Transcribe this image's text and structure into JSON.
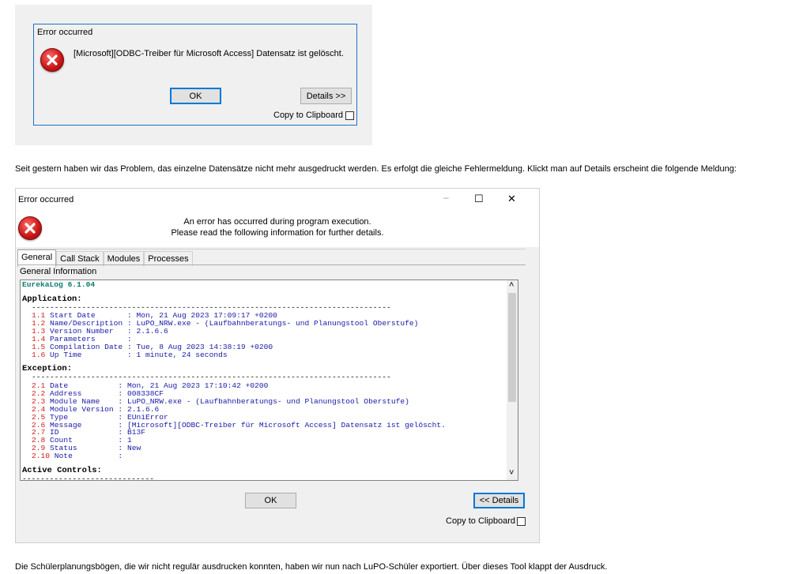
{
  "dialog1": {
    "title": "Error occurred",
    "message": "[Microsoft][ODBC-Treiber für Microsoft Access] Datensatz ist gelöscht.",
    "ok_label": "OK",
    "details_label": "Details >>",
    "clipboard_label": "Copy to Clipboard"
  },
  "paragraph1": "Seit gestern haben wir das Problem, das einzelne Datensätze nicht mehr ausgedruckt werden. Es erfolgt die gleiche Fehlermeldung. Klickt man auf Details erscheint die folgende Meldung:",
  "dialog2": {
    "title": "Error occurred",
    "window_controls": {
      "minimize": "–",
      "maximize": "☐",
      "close": "✕"
    },
    "header_line1": "An error has occurred during program execution.",
    "header_line2": "Please read the following information for further details.",
    "tabs": [
      "General",
      "Call Stack",
      "Modules",
      "Processes"
    ],
    "section_label": "General Information",
    "log": {
      "version": "EurekaLog 6.1.04",
      "application_header": "Application:",
      "separator": "-------------------------------------------------------------------------------",
      "application": [
        {
          "num": "1.1",
          "key": "Start Date      ",
          "value": "Mon, 21 Aug 2023 17:09:17 +0200"
        },
        {
          "num": "1.2",
          "key": "Name/Description",
          "value": "LuPO_NRW.exe - (Laufbahnberatungs- und Planungstool Oberstufe)"
        },
        {
          "num": "1.3",
          "key": "Version Number  ",
          "value": "2.1.6.6"
        },
        {
          "num": "1.4",
          "key": "Parameters      ",
          "value": ""
        },
        {
          "num": "1.5",
          "key": "Compilation Date",
          "value": "Tue, 8 Aug 2023 14:38:19 +0200"
        },
        {
          "num": "1.6",
          "key": "Up Time         ",
          "value": "1 minute, 24 seconds"
        }
      ],
      "exception_header": "Exception:",
      "exception": [
        {
          "num": "2.1",
          "key": "Date          ",
          "value": "Mon, 21 Aug 2023 17:10:42 +0200"
        },
        {
          "num": "2.2",
          "key": "Address       ",
          "value": "008338CF"
        },
        {
          "num": "2.3",
          "key": "Module Name   ",
          "value": "LuPO_NRW.exe - (Laufbahnberatungs- und Planungstool Oberstufe)"
        },
        {
          "num": "2.4",
          "key": "Module Version",
          "value": "2.1.6.6"
        },
        {
          "num": "2.5",
          "key": "Type          ",
          "value": "EUniError"
        },
        {
          "num": "2.6",
          "key": "Message       ",
          "value": "[Microsoft][ODBC-Treiber für Microsoft Access] Datensatz ist gelöscht."
        },
        {
          "num": "2.7",
          "key": "ID            ",
          "value": "B13F"
        },
        {
          "num": "2.8",
          "key": "Count         ",
          "value": "1"
        },
        {
          "num": "2.9",
          "key": "Status        ",
          "value": "New"
        },
        {
          "num": "2.10",
          "key": "Note         ",
          "value": ""
        }
      ],
      "active_controls_header": "Active Controls:",
      "separator_short": "-----------------------------"
    },
    "ok_label": "OK",
    "details_label": "<< Details",
    "clipboard_label": "Copy to Clipboard",
    "scroll_up": "˄",
    "scroll_down": "˅"
  },
  "paragraph2": "Die Schülerplanungsbögen, die wir nicht regulär ausdrucken konnten, haben wir nun nach LuPO-Schüler exportiert. Über dieses Tool klappt der Ausdruck."
}
